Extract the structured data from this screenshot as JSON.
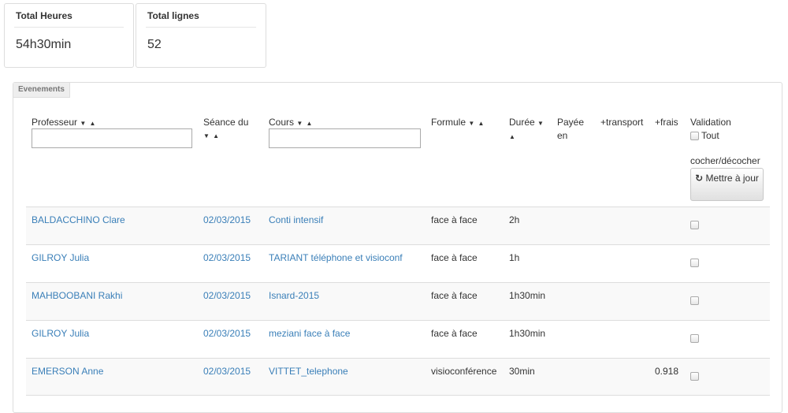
{
  "stats": [
    {
      "title": "Total Heures",
      "value": "54h30min"
    },
    {
      "title": "Total lignes",
      "value": "52"
    }
  ],
  "panel": {
    "tab_label": "Evenements"
  },
  "columns": {
    "professeur": "Professeur",
    "seance_line1": "Séance du",
    "cours": "Cours",
    "formule": "Formule",
    "duree": "Durée",
    "payee_line1": "Payée",
    "payee_line2": "en",
    "transport": "+transport",
    "frais": "+frais",
    "validation": "Validation",
    "tout": "Tout",
    "cocher": "cocher/décocher",
    "update_button": "Mettre à jour"
  },
  "sort_glyphs": {
    "desc": "▼",
    "asc": "▲"
  },
  "icons": {
    "refresh": "refresh-icon"
  },
  "rows": [
    {
      "professeur": "BALDACCHINO Clare",
      "seance": "02/03/2015",
      "cours": "Conti intensif",
      "formule": "face à face",
      "duree": "2h",
      "frais": ""
    },
    {
      "professeur": "GILROY Julia",
      "seance": "02/03/2015",
      "cours": "TARIANT téléphone et visioconf",
      "formule": "face à face",
      "duree": "1h",
      "frais": ""
    },
    {
      "professeur": "MAHBOOBANI Rakhi",
      "seance": "02/03/2015",
      "cours": "Isnard-2015",
      "formule": "face à face",
      "duree": "1h30min",
      "frais": ""
    },
    {
      "professeur": "GILROY Julia",
      "seance": "02/03/2015",
      "cours": "meziani face à face",
      "formule": "face à face",
      "duree": "1h30min",
      "frais": ""
    },
    {
      "professeur": "EMERSON Anne",
      "seance": "02/03/2015",
      "cours": "VITTET_telephone",
      "formule": "visioconférence",
      "duree": "30min",
      "frais": "0.918"
    }
  ],
  "colors": {
    "link": "#3a7fb8",
    "stripe": "#f9f9f9",
    "border": "#dddddd"
  }
}
